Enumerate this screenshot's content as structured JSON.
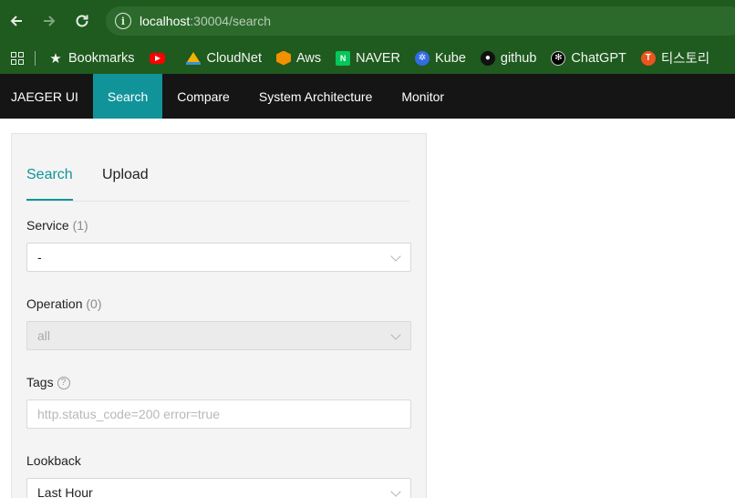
{
  "browser": {
    "url_host": "localhost",
    "url_rest": ":30004/search",
    "bookmarks": [
      {
        "label": "Bookmarks",
        "icon": "star-icon"
      },
      {
        "label": "",
        "icon": "youtube-icon"
      },
      {
        "label": "CloudNet",
        "icon": "cloudnet-icon"
      },
      {
        "label": "Aws",
        "icon": "aws-icon"
      },
      {
        "label": "NAVER",
        "icon": "naver-icon",
        "glyph": "N"
      },
      {
        "label": "Kube",
        "icon": "kubernetes-icon"
      },
      {
        "label": "github",
        "icon": "github-icon"
      },
      {
        "label": "ChatGPT",
        "icon": "chatgpt-icon"
      },
      {
        "label": "티스토리",
        "icon": "tistory-icon"
      }
    ]
  },
  "topnav": {
    "brand": "JAEGER UI",
    "items": [
      {
        "label": "Search",
        "active": true
      },
      {
        "label": "Compare"
      },
      {
        "label": "System Architecture"
      },
      {
        "label": "Monitor"
      }
    ]
  },
  "panel": {
    "tabs": [
      {
        "label": "Search",
        "active": true
      },
      {
        "label": "Upload"
      }
    ],
    "service": {
      "label": "Service",
      "count": "(1)",
      "value": "-"
    },
    "operation": {
      "label": "Operation",
      "count": "(0)",
      "value": "all"
    },
    "tags": {
      "label": "Tags",
      "placeholder": "http.status_code=200 error=true"
    },
    "lookback": {
      "label": "Lookback",
      "value": "Last Hour"
    }
  },
  "colors": {
    "accent": "#11939a",
    "nav_bg": "#151515",
    "browser_bg": "#1f5a1f"
  }
}
